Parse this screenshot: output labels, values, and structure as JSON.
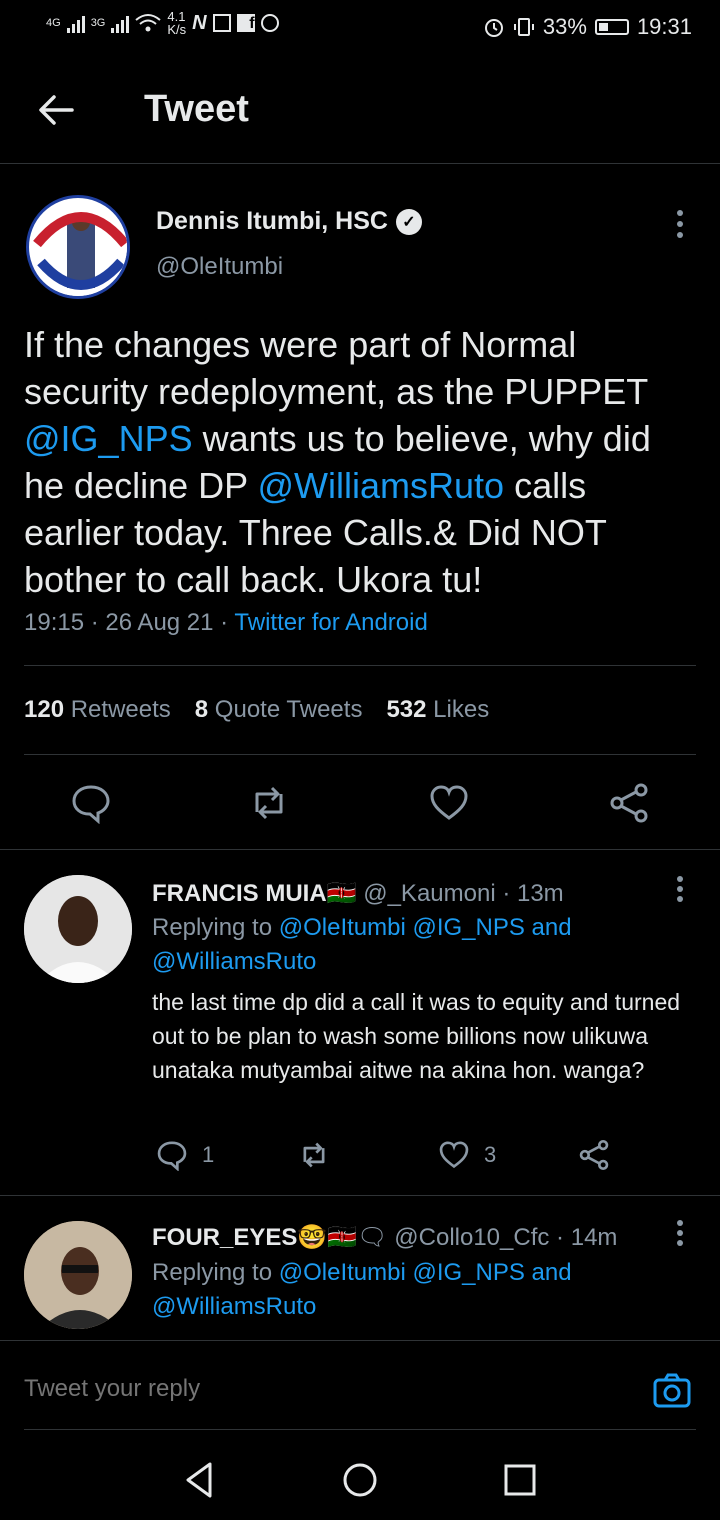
{
  "status_bar": {
    "network_left": "4G",
    "network_right": "3G",
    "speed": "4.1",
    "speed_unit": "K/s",
    "battery": "33%",
    "time": "19:31"
  },
  "header": {
    "title": "Tweet"
  },
  "tweet": {
    "author_name": "Dennis Itumbi, HSC",
    "author_handle": "@OleItumbi",
    "text_1": "If the changes were part of Normal security redeployment, as the PUPPET ",
    "mention_1": "@IG_NPS",
    "text_2": " wants us to believe, why did he decline DP ",
    "mention_2": "@WilliamsRuto",
    "text_3": " calls earlier today. Three Calls.& Did NOT bother to call back. Ukora tu!",
    "time": "19:15",
    "date": "26 Aug 21",
    "source": "Twitter for Android",
    "stats": {
      "retweets_count": "120",
      "retweets_label": "Retweets",
      "quotes_count": "8",
      "quotes_label": "Quote Tweets",
      "likes_count": "532",
      "likes_label": "Likes"
    }
  },
  "replies": [
    {
      "name": "FRANCIS MUIA",
      "emoji": "🇰🇪",
      "handle": "@_Kaumoni",
      "time": "13m",
      "replying_label": "Replying to",
      "replying_handles": "@OleItumbi @IG_NPS and",
      "replying_handles_2": "@WilliamsRuto",
      "text": "the last time dp did a call it was to equity and turned out to be plan to wash some billions now ulikuwa unataka mutyambai aitwe na akina hon. wanga?",
      "reply_count": "1",
      "like_count": "3"
    },
    {
      "name": "FOUR_EYES",
      "emoji": "🤓🇰🇪🗨",
      "handle": "@Collo10_Cfc",
      "time": "14m",
      "replying_label": "Replying to",
      "replying_handles": "@OleItumbi @IG_NPS and",
      "replying_handles_2": "@WilliamsRuto"
    }
  ],
  "composer": {
    "placeholder": "Tweet your reply"
  },
  "colors": {
    "accent": "#1d9bf0",
    "background": "#000000",
    "muted": "#8b98a5",
    "divider": "#2f3336"
  }
}
